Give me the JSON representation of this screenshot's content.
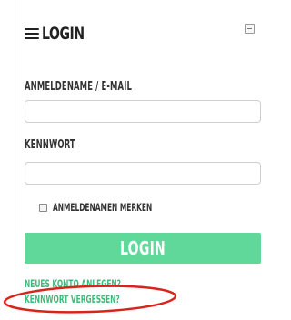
{
  "header": {
    "title": "LOGIN",
    "menu_icon": "hamburger-menu-icon",
    "minimize_icon": "minimize-icon"
  },
  "form": {
    "username_label": "ANMELDENAME / E-MAIL",
    "username_value": "",
    "password_label": "KENNWORT",
    "password_value": "",
    "remember_label": "ANMELDENAMEN MERKEN",
    "remember_checked": false,
    "submit_label": "LOGIN"
  },
  "links": {
    "new_account": "NEUES KONTO ANLEGEN?",
    "forgot_password": "KENNWORT VERGESSEN?"
  },
  "colors": {
    "accent": "#5fd89a",
    "link": "#3dbb7a",
    "highlight_oval": "#d9241c"
  }
}
